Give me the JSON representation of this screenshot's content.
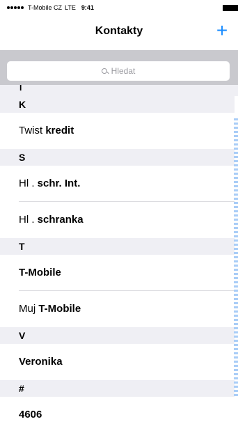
{
  "status_bar": {
    "carrier": "T-Mobile CZ",
    "network": "LTE",
    "time": "9:41"
  },
  "nav": {
    "title": "Kontakty",
    "add_icon": "+"
  },
  "search": {
    "placeholder": "Hledat"
  },
  "list": {
    "partial_header": "I",
    "sections": [
      {
        "letter": "K",
        "rows": [
          {
            "light": "Twist ",
            "bold": "kredit"
          }
        ]
      },
      {
        "letter": "S",
        "rows": [
          {
            "light": "Hl . ",
            "bold": "schr. Int."
          },
          {
            "light": "Hl . ",
            "bold": "schranka"
          }
        ]
      },
      {
        "letter": "T",
        "rows": [
          {
            "light": "",
            "bold": "T-Mobile"
          },
          {
            "light": "Muj ",
            "bold": "T-Mobile"
          }
        ]
      },
      {
        "letter": "V",
        "rows": [
          {
            "light": "",
            "bold": "Veronika"
          }
        ]
      },
      {
        "letter": "#",
        "rows": [
          {
            "light": "",
            "bold": "4606"
          }
        ]
      }
    ]
  },
  "colors": {
    "accent": "#1a8cff",
    "header_bg": "#efeff4",
    "search_band": "#c9c9ce"
  }
}
